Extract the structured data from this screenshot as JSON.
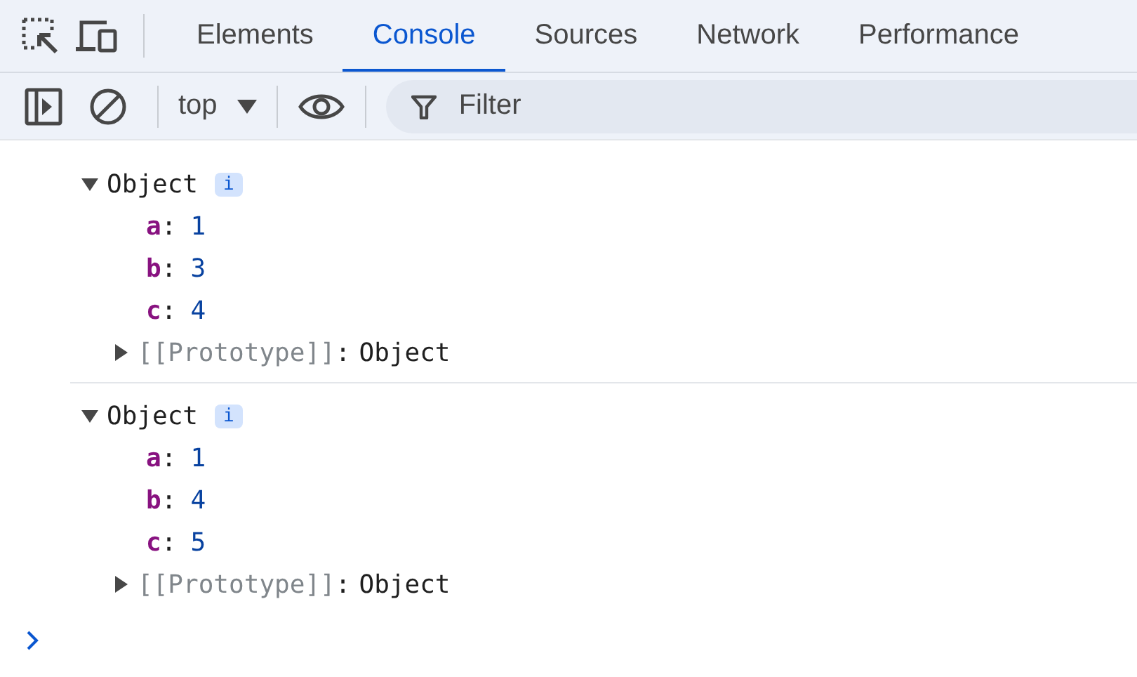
{
  "tabs": [
    {
      "label": "Elements",
      "selected": false
    },
    {
      "label": "Console",
      "selected": true
    },
    {
      "label": "Sources",
      "selected": false
    },
    {
      "label": "Network",
      "selected": false
    },
    {
      "label": "Performance",
      "selected": false
    }
  ],
  "toolbar": {
    "context": "top",
    "filter": {
      "placeholder": "Filter"
    }
  },
  "entries": [
    {
      "label": "Object",
      "expanded": true,
      "info": "i",
      "properties": [
        {
          "key": "a",
          "separator": ":",
          "value": "1"
        },
        {
          "key": "b",
          "separator": ":",
          "value": "3"
        },
        {
          "key": "c",
          "separator": ":",
          "value": "4"
        }
      ],
      "prototype": {
        "key": "[[Prototype]]",
        "separator": ":",
        "value": "Object",
        "expanded": false
      }
    },
    {
      "label": "Object",
      "expanded": true,
      "info": "i",
      "properties": [
        {
          "key": "a",
          "separator": ":",
          "value": "1"
        },
        {
          "key": "b",
          "separator": ":",
          "value": "4"
        },
        {
          "key": "c",
          "separator": ":",
          "value": "5"
        }
      ],
      "prototype": {
        "key": "[[Prototype]]",
        "separator": ":",
        "value": "Object",
        "expanded": false
      }
    }
  ]
}
